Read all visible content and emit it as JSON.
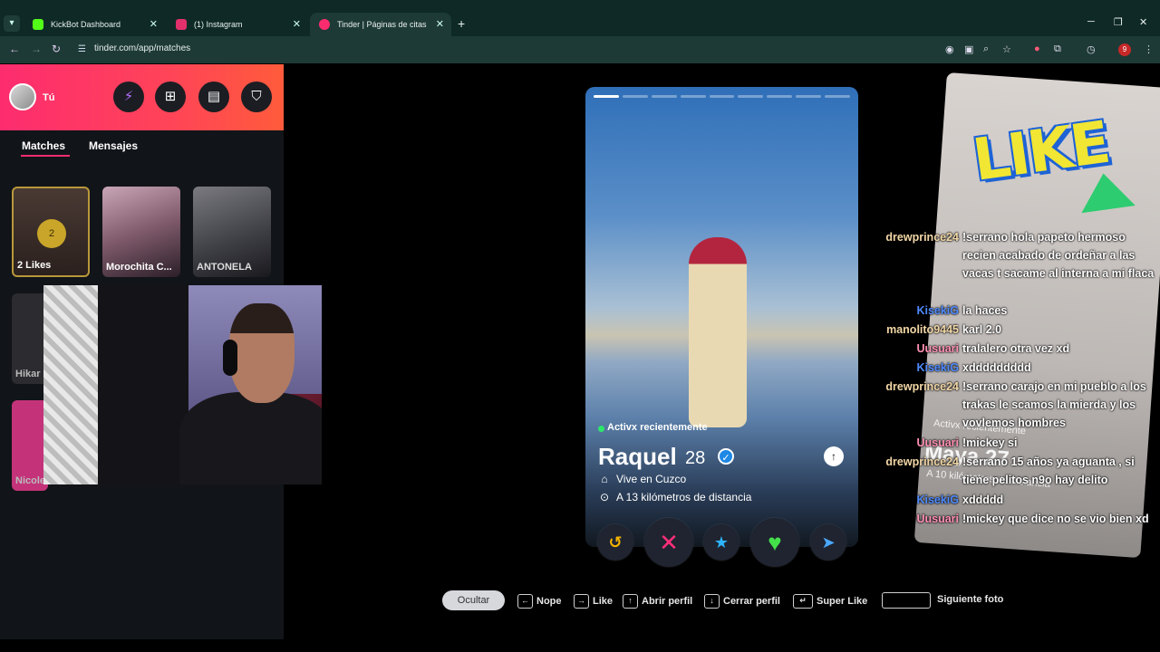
{
  "browser": {
    "tabs": [
      {
        "title": "KickBot Dashboard",
        "color": "#53fc18"
      },
      {
        "title": "(1) Instagram",
        "color": "#e1306c"
      },
      {
        "title": "Tinder | Páginas de citas",
        "color": "#fd2c6f"
      }
    ],
    "url": "tinder.com/app/matches",
    "notif_count": "9"
  },
  "sidebar": {
    "user_label": "Tú",
    "tabs": [
      "Matches",
      "Mensajes"
    ],
    "likes_count": "2",
    "likes_label": "2 Likes",
    "matches": [
      {
        "name": "Morochita C..."
      },
      {
        "name": "ANTONELA"
      },
      {
        "name": "Hikar"
      },
      {
        "name": "Nicole"
      }
    ]
  },
  "profile": {
    "status": "Activx recientemente",
    "name": "Raquel",
    "age": "28",
    "lives": "Vive en Cuzco",
    "distance": "A 13 kilómetros de distancia",
    "photo_count": 9,
    "current_photo": 1
  },
  "shortcuts": {
    "hide": "Ocultar",
    "nope": "Nope",
    "like": "Like",
    "open": "Abrir perfil",
    "close": "Cerrar perfil",
    "superlike": "Super Like",
    "next": "Siguiente foto"
  },
  "overlay": {
    "logo": "LIKE",
    "ghost_status": "Activx recientemente",
    "ghost_name": "Maya 27",
    "ghost_distance": "A 10 kilómetros de distancia"
  },
  "chat": [
    {
      "user": "drewprince24",
      "color": "#f2d7a6",
      "text": "!serrano hola papeto hermoso recien acabado de ordeñar a las vacas t sacame al interna a mi flaca"
    },
    {
      "user": "KisekiG",
      "color": "#4f8bff",
      "text": "la haces"
    },
    {
      "user": "manolito9445",
      "color": "#f2d7a6",
      "text": "karl 2.0"
    },
    {
      "user": "Uusuari",
      "color": "#ff8fb3",
      "text": "tralalero otra vez xd"
    },
    {
      "user": "KisekiG",
      "color": "#4f8bff",
      "text": "xddddddddd"
    },
    {
      "user": "drewprince24",
      "color": "#f2d7a6",
      "text": "!serrano carajo en mi pueblo a los trakas le scamos la mierda y los vovlemos hombres"
    },
    {
      "user": "Uusuari",
      "color": "#ff8fb3",
      "text": "!mickey si"
    },
    {
      "user": "drewprince24",
      "color": "#f2d7a6",
      "text": "!serrano 15 años ya aguanta , si tiene pelitos n9o hay delito"
    },
    {
      "user": "KisekiG",
      "color": "#4f8bff",
      "text": "xddddd"
    },
    {
      "user": "Uusuari",
      "color": "#ff8fb3",
      "text": "!mickey que dice no se vio bien xd"
    }
  ]
}
